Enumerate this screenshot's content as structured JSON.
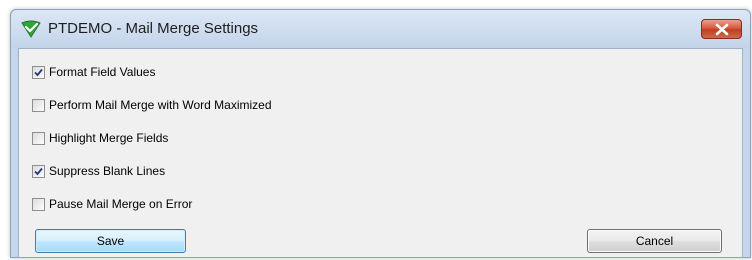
{
  "window": {
    "title": "PTDEMO - Mail Merge Settings",
    "app_icon": "ptdemo-app-icon",
    "close_icon": "close-icon",
    "accent_close": "#c13d20"
  },
  "options": [
    {
      "label": "Format Field Values",
      "checked": true
    },
    {
      "label": "Perform Mail Merge with Word Maximized",
      "checked": false
    },
    {
      "label": "Highlight Merge Fields",
      "checked": false
    },
    {
      "label": "Suppress Blank Lines",
      "checked": true
    },
    {
      "label": "Pause Mail Merge on Error",
      "checked": false
    }
  ],
  "buttons": {
    "save_label": "Save",
    "cancel_label": "Cancel"
  }
}
